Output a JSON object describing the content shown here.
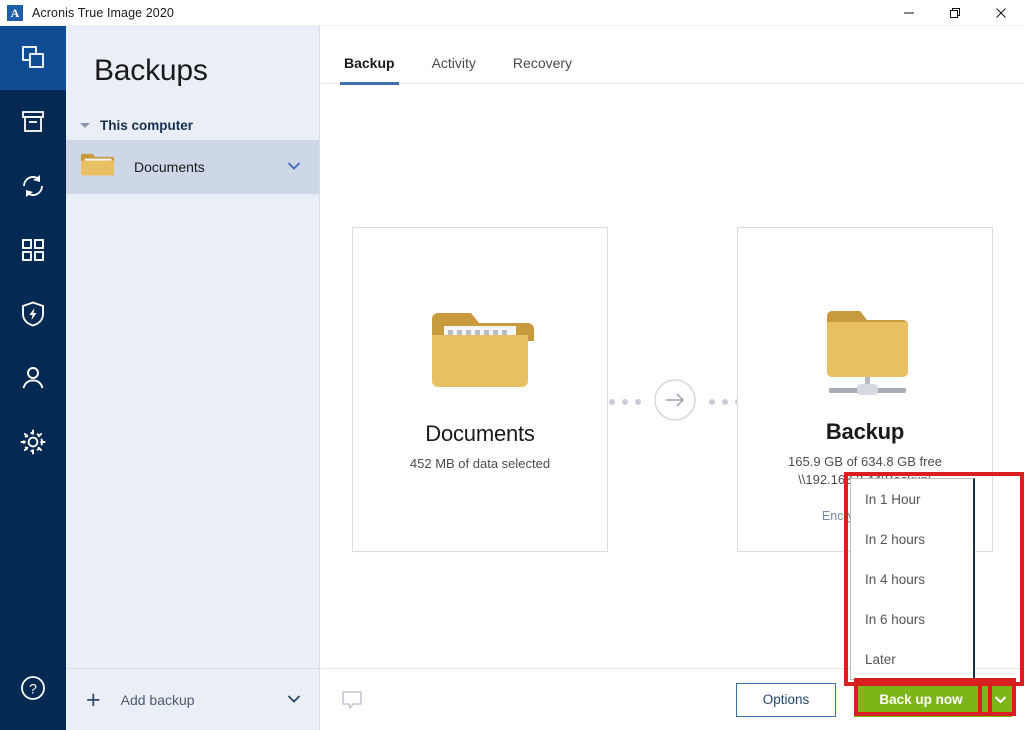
{
  "window": {
    "app_icon": "acronis-a-logo",
    "title": "Acronis True Image 2020",
    "controls": {
      "minimize": "minimize-icon",
      "restore": "restore-icon",
      "close": "close-icon"
    }
  },
  "rail": {
    "items": [
      {
        "name": "backup",
        "icon": "stacked-squares-icon",
        "active": true
      },
      {
        "name": "archive",
        "icon": "archive-box-icon",
        "active": false
      },
      {
        "name": "sync",
        "icon": "sync-arrows-icon",
        "active": false
      },
      {
        "name": "tools",
        "icon": "four-squares-icon",
        "active": false
      },
      {
        "name": "protection",
        "icon": "shield-bolt-icon",
        "active": false
      },
      {
        "name": "account",
        "icon": "person-icon",
        "active": false
      },
      {
        "name": "settings",
        "icon": "gear-icon",
        "active": false
      }
    ],
    "help": {
      "name": "help",
      "icon": "question-circle-icon"
    }
  },
  "sidebar": {
    "title": "Backups",
    "group": {
      "label": "This computer",
      "expanded": true,
      "caret": "caret-down-icon"
    },
    "items": [
      {
        "label": "Documents",
        "icon": "folder-icon",
        "chevron": "chevron-down-icon",
        "selected": true
      }
    ],
    "add_backup": {
      "label": "Add backup",
      "plus": "plus-icon",
      "chevron": "chevron-down-icon"
    }
  },
  "main": {
    "tabs": [
      {
        "label": "Backup",
        "active": true
      },
      {
        "label": "Activity",
        "active": false
      },
      {
        "label": "Recovery",
        "active": false
      }
    ],
    "source": {
      "icon": "folder-documents-icon",
      "title": "Documents",
      "subtitle": "452 MB of data selected"
    },
    "connector": {
      "icon": "arrow-right-circle-icon",
      "dots": 3
    },
    "destination": {
      "icon": "network-folder-icon",
      "title": "Backup",
      "subtitle": "165.9 GB of 634.8 GB free",
      "path": "\\\\192.168.3.44\\Backup\\",
      "encrypt_link": "Encrypt backup"
    },
    "actionbar": {
      "comment_icon": "comment-icon",
      "options_label": "Options",
      "backup_label": "Back up now",
      "backup_caret": "chevron-down-icon"
    }
  },
  "dropdown": {
    "open": true,
    "items": [
      {
        "label": "In 1 Hour"
      },
      {
        "label": "In 2 hours"
      },
      {
        "label": "In 4 hours"
      },
      {
        "label": "In 6 hours"
      },
      {
        "label": "Later"
      }
    ]
  },
  "annotations": {
    "color": "#d82020",
    "regions": [
      "dropdown-menu",
      "back-up-now-button",
      "back-up-now-caret"
    ]
  }
}
